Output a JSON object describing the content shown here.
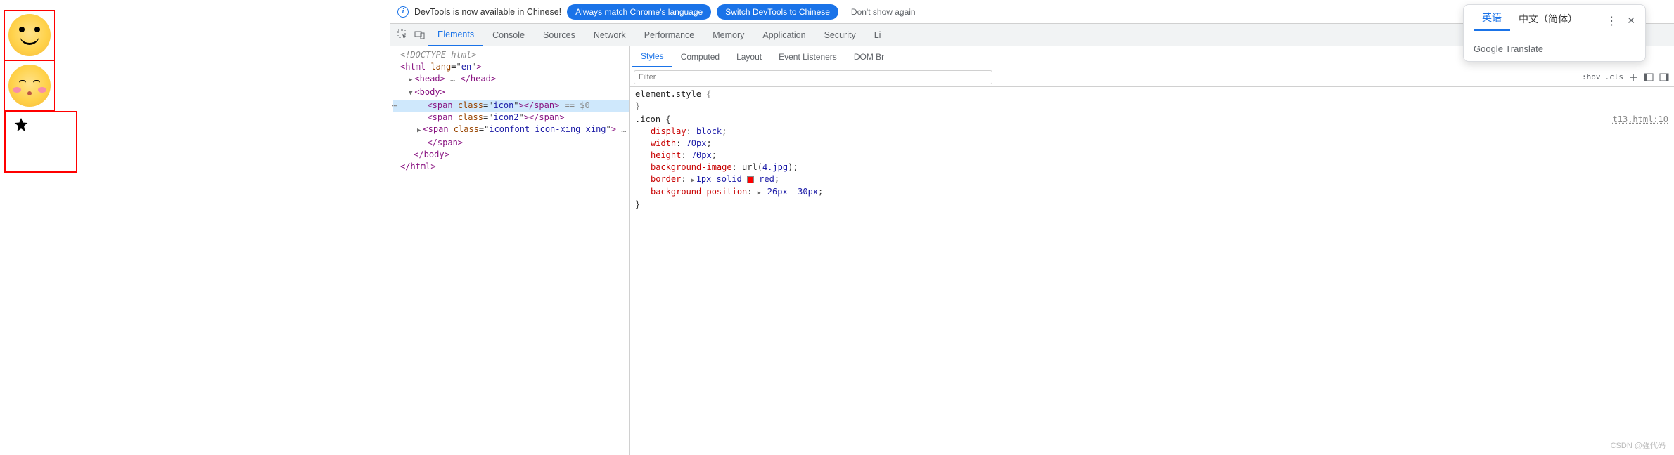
{
  "infobar": {
    "message": "DevTools is now available in Chinese!",
    "always_match": "Always match Chrome's language",
    "switch_to": "Switch DevTools to Chinese",
    "dont_show": "Don't show again"
  },
  "tabs": [
    "Elements",
    "Console",
    "Sources",
    "Network",
    "Performance",
    "Memory",
    "Application",
    "Security",
    "Li"
  ],
  "active_tab": 0,
  "dom": {
    "doctype": "<!DOCTYPE html>",
    "html_open": {
      "tag": "html",
      "attr": "lang",
      "val": "en"
    },
    "head": {
      "tag": "head",
      "ell": "…"
    },
    "body_open": {
      "tag": "body"
    },
    "span1": {
      "tag": "span",
      "attr": "class",
      "val": "icon",
      "eq": "== $0"
    },
    "span2": {
      "tag": "span",
      "attr": "class",
      "val": "icon2"
    },
    "span3": {
      "tag": "span",
      "attr": "class",
      "val": "iconfont icon-xing xing",
      "ell": "…"
    },
    "span_close": "span",
    "body_close": "body",
    "html_close": "html"
  },
  "subtabs": [
    "Styles",
    "Computed",
    "Layout",
    "Event Listeners",
    "DOM Br"
  ],
  "active_subtab": 0,
  "filter_placeholder": "Filter",
  "toolbar": {
    "hov": ":hov",
    "cls": ".cls"
  },
  "css": {
    "element_style": "element.style",
    "rule_sel": ".icon",
    "rule_src": "t13.html:10",
    "decls": [
      {
        "prop": "display",
        "val": "block"
      },
      {
        "prop": "width",
        "val": "70px"
      },
      {
        "prop": "height",
        "val": "70px"
      },
      {
        "prop": "background-image",
        "val_pre": "url(",
        "link": "4.jpg",
        "val_post": ")"
      },
      {
        "prop": "border",
        "tri": true,
        "val": "1px solid ",
        "swatch": true,
        "color": "red"
      },
      {
        "prop": "background-position",
        "tri": true,
        "val": "-26px -30px"
      }
    ]
  },
  "translate": {
    "lang1": "英语",
    "lang2": "中文（简体）",
    "brand_bold": "Google",
    "brand_light": " Translate"
  },
  "watermark": "CSDN @强代码"
}
